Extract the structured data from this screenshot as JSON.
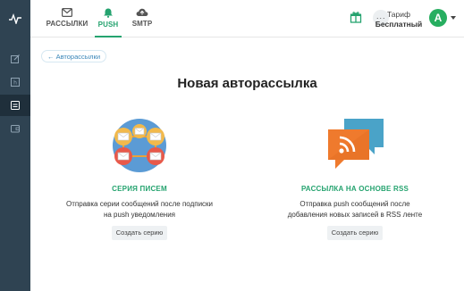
{
  "sidebar": {
    "logo_icon": "pulse-icon",
    "items": [
      {
        "icon": "edit-icon",
        "active": false
      },
      {
        "icon": "html-icon",
        "active": false
      },
      {
        "icon": "autoresponder-icon",
        "active": true
      },
      {
        "icon": "wallet-icon",
        "active": false
      }
    ]
  },
  "topbar": {
    "tabs": [
      {
        "label": "РАССЫЛКИ",
        "icon": "envelope-icon",
        "active": false
      },
      {
        "label": "PUSH",
        "icon": "bell-icon",
        "active": true
      },
      {
        "label": "SMTP",
        "icon": "cloud-upload-icon",
        "active": false
      }
    ],
    "more_label": "···",
    "tariff_title": "Тариф",
    "tariff_plan": "Бесплатный",
    "avatar_letter": "A"
  },
  "main": {
    "back_label": "← Авторассылки",
    "title": "Новая авторассылка",
    "cards": [
      {
        "title": "СЕРИЯ ПИСЕМ",
        "description_line1": "Отправка серии сообщений после подписки",
        "description_line2": "на push уведомления",
        "button": "Создать серию"
      },
      {
        "title": "РАССЫЛКА НА ОСНОВЕ RSS",
        "description_line1": "Отправка push сообщений после",
        "description_line2": "добавления новых записей в RSS ленте",
        "button": "Создать серию"
      }
    ]
  },
  "colors": {
    "accent": "#25a36f",
    "sidebar": "#2f4352",
    "link": "#3a86b8"
  }
}
